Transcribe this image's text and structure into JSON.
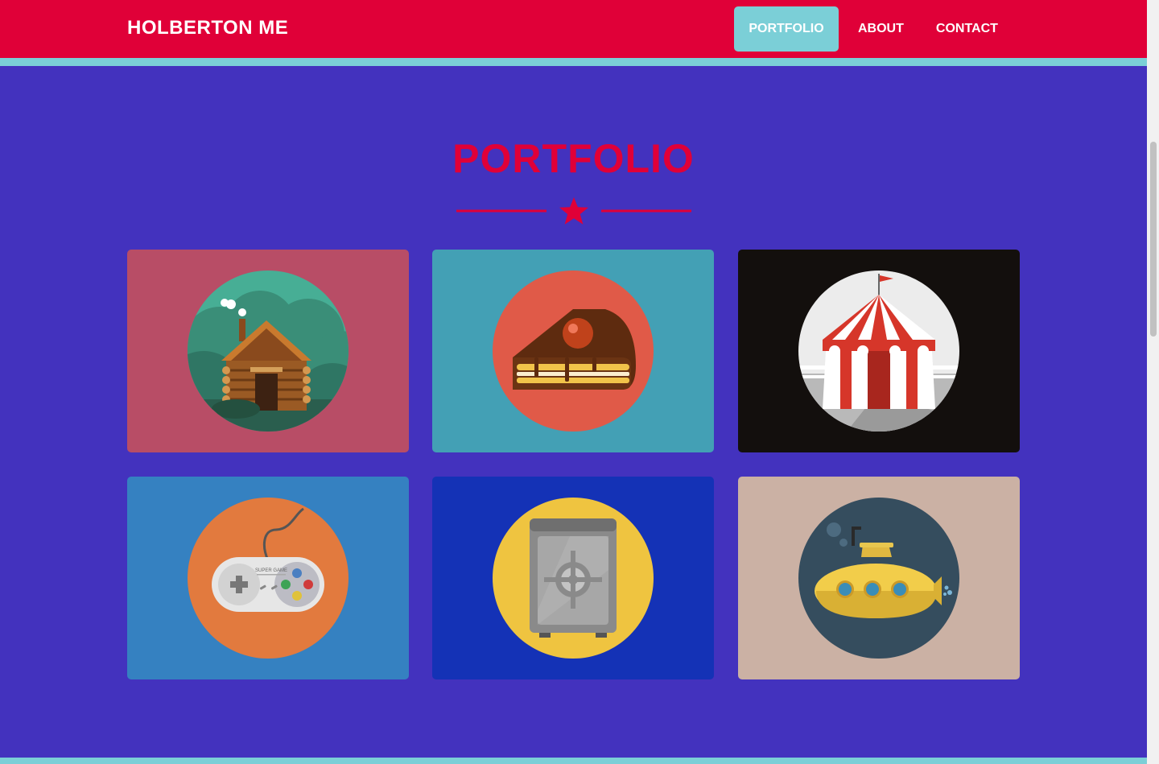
{
  "brand": "HOLBERTON ME",
  "nav": {
    "items": [
      {
        "label": "PORTFOLIO",
        "active": true
      },
      {
        "label": "ABOUT",
        "active": false
      },
      {
        "label": "CONTACT",
        "active": false
      }
    ]
  },
  "section": {
    "title": "PORTFOLIO",
    "divider_icon": "star-icon"
  },
  "portfolio": [
    {
      "icon": "log-cabin-icon",
      "bg": "#b84d66"
    },
    {
      "icon": "cake-slice-icon",
      "bg": "#43a0b5"
    },
    {
      "icon": "circus-tent-icon",
      "bg": "#130f0d"
    },
    {
      "icon": "gamepad-icon",
      "bg": "#3581c1"
    },
    {
      "icon": "safe-icon",
      "bg": "#1432b6"
    },
    {
      "icon": "submarine-icon",
      "bg": "#cbb1a4"
    }
  ],
  "colors": {
    "navbar": "#e00038",
    "accent": "#7bcfd7",
    "background": "#4332be",
    "heading": "#e00038"
  },
  "gamepad_text": "SUPER GAME"
}
